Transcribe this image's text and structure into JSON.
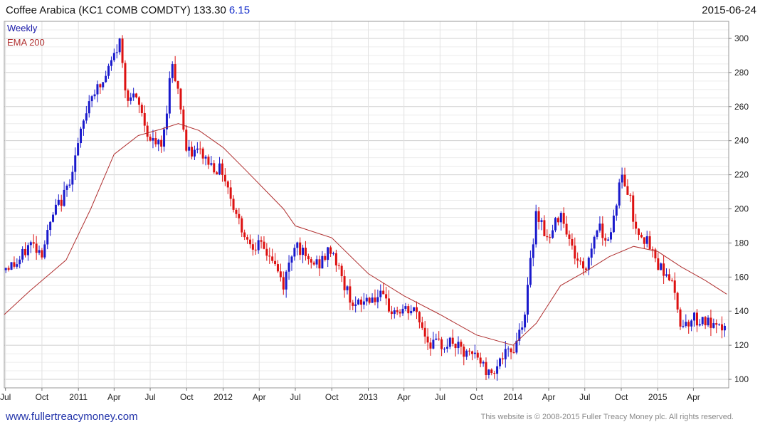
{
  "header": {
    "title": "Coffee Arabica  (KC1 COMB COMDTY) 133.30",
    "change": "6.15",
    "date": "2015-06-24"
  },
  "legend": {
    "weekly": "Weekly",
    "ema": "EMA 200"
  },
  "footer": {
    "website": "www.fullertreacymoney.com",
    "copyright": "This website is © 2008-2015 Fuller Treacy Money plc. All rights reserved."
  },
  "colors": {
    "up": "#1a1acc",
    "down": "#dd1111",
    "ema": "#b03030",
    "grid": "#dcdcdc"
  },
  "chart_data": {
    "type": "candlestick",
    "series_names": [
      "Weekly",
      "EMA 200"
    ],
    "ylim": [
      95,
      310
    ],
    "y_ticks": [
      100,
      120,
      140,
      160,
      180,
      200,
      220,
      240,
      260,
      280,
      300
    ],
    "x_range": [
      "2010-06-28",
      "2015-06-29"
    ],
    "x_ticks": [
      {
        "label": "Jul",
        "date": "2010-07-01"
      },
      {
        "label": "Oct",
        "date": "2010-10-01"
      },
      {
        "label": "2011",
        "date": "2011-01-01"
      },
      {
        "label": "Apr",
        "date": "2011-04-01"
      },
      {
        "label": "Jul",
        "date": "2011-07-01"
      },
      {
        "label": "Oct",
        "date": "2011-10-01"
      },
      {
        "label": "2012",
        "date": "2012-01-01"
      },
      {
        "label": "Apr",
        "date": "2012-04-01"
      },
      {
        "label": "Jul",
        "date": "2012-07-01"
      },
      {
        "label": "Oct",
        "date": "2012-10-01"
      },
      {
        "label": "2013",
        "date": "2013-01-01"
      },
      {
        "label": "Apr",
        "date": "2013-04-01"
      },
      {
        "label": "Jul",
        "date": "2013-07-01"
      },
      {
        "label": "Oct",
        "date": "2013-10-01"
      },
      {
        "label": "2014",
        "date": "2014-01-01"
      },
      {
        "label": "Apr",
        "date": "2014-04-01"
      },
      {
        "label": "Jul",
        "date": "2014-07-01"
      },
      {
        "label": "Oct",
        "date": "2014-10-01"
      },
      {
        "label": "2015",
        "date": "2015-01-01"
      },
      {
        "label": "Apr",
        "date": "2015-04-01"
      }
    ],
    "close_path": [
      [
        "2010-07-01",
        166
      ],
      [
        "2010-08-01",
        168
      ],
      [
        "2010-09-01",
        180
      ],
      [
        "2010-10-01",
        175
      ],
      [
        "2010-11-01",
        198
      ],
      [
        "2010-12-01",
        210
      ],
      [
        "2011-01-01",
        238
      ],
      [
        "2011-02-01",
        268
      ],
      [
        "2011-03-01",
        272
      ],
      [
        "2011-04-15",
        298
      ],
      [
        "2011-05-01",
        268
      ],
      [
        "2011-06-01",
        262
      ],
      [
        "2011-07-01",
        240
      ],
      [
        "2011-08-01",
        236
      ],
      [
        "2011-08-25",
        288
      ],
      [
        "2011-09-15",
        262
      ],
      [
        "2011-10-01",
        232
      ],
      [
        "2011-11-01",
        234
      ],
      [
        "2011-12-01",
        226
      ],
      [
        "2012-01-01",
        222
      ],
      [
        "2012-02-01",
        198
      ],
      [
        "2012-03-01",
        182
      ],
      [
        "2012-04-01",
        178
      ],
      [
        "2012-05-01",
        172
      ],
      [
        "2012-06-01",
        155
      ],
      [
        "2012-07-01",
        182
      ],
      [
        "2012-08-01",
        168
      ],
      [
        "2012-09-01",
        168
      ],
      [
        "2012-10-01",
        177
      ],
      [
        "2012-11-01",
        155
      ],
      [
        "2012-12-01",
        142
      ],
      [
        "2013-01-01",
        148
      ],
      [
        "2013-02-01",
        148
      ],
      [
        "2013-03-01",
        140
      ],
      [
        "2013-04-01",
        140
      ],
      [
        "2013-05-01",
        140
      ],
      [
        "2013-06-01",
        122
      ],
      [
        "2013-07-01",
        120
      ],
      [
        "2013-08-01",
        122
      ],
      [
        "2013-09-01",
        114
      ],
      [
        "2013-10-01",
        114
      ],
      [
        "2013-11-01",
        103
      ],
      [
        "2013-12-01",
        112
      ],
      [
        "2014-01-01",
        117
      ],
      [
        "2014-02-01",
        140
      ],
      [
        "2014-03-01",
        200
      ],
      [
        "2014-04-01",
        180
      ],
      [
        "2014-05-01",
        200
      ],
      [
        "2014-06-01",
        175
      ],
      [
        "2014-07-01",
        163
      ],
      [
        "2014-08-01",
        190
      ],
      [
        "2014-09-01",
        182
      ],
      [
        "2014-10-01",
        220
      ],
      [
        "2014-10-25",
        205
      ],
      [
        "2014-11-01",
        192
      ],
      [
        "2014-12-01",
        182
      ],
      [
        "2015-01-01",
        168
      ],
      [
        "2015-02-01",
        160
      ],
      [
        "2015-02-20",
        142
      ],
      [
        "2015-03-01",
        132
      ],
      [
        "2015-04-01",
        136
      ],
      [
        "2015-05-01",
        134
      ],
      [
        "2015-06-01",
        128
      ],
      [
        "2015-06-24",
        133.3
      ]
    ],
    "ema_200": [
      [
        "2010-06-28",
        138
      ],
      [
        "2010-09-01",
        152
      ],
      [
        "2010-12-01",
        170
      ],
      [
        "2011-02-01",
        200
      ],
      [
        "2011-04-01",
        232
      ],
      [
        "2011-06-01",
        243
      ],
      [
        "2011-08-01",
        247
      ],
      [
        "2011-09-10",
        250
      ],
      [
        "2011-11-01",
        246
      ],
      [
        "2012-01-01",
        236
      ],
      [
        "2012-03-01",
        222
      ],
      [
        "2012-06-01",
        200
      ],
      [
        "2012-07-01",
        190
      ],
      [
        "2012-10-01",
        183
      ],
      [
        "2013-01-01",
        162
      ],
      [
        "2013-04-01",
        149
      ],
      [
        "2013-07-01",
        138
      ],
      [
        "2013-10-01",
        126
      ],
      [
        "2014-01-01",
        120
      ],
      [
        "2014-03-01",
        133
      ],
      [
        "2014-05-01",
        155
      ],
      [
        "2014-07-01",
        163
      ],
      [
        "2014-09-01",
        172
      ],
      [
        "2014-11-01",
        178
      ],
      [
        "2015-01-01",
        175
      ],
      [
        "2015-03-01",
        166
      ],
      [
        "2015-05-01",
        158
      ],
      [
        "2015-06-24",
        150
      ]
    ]
  }
}
